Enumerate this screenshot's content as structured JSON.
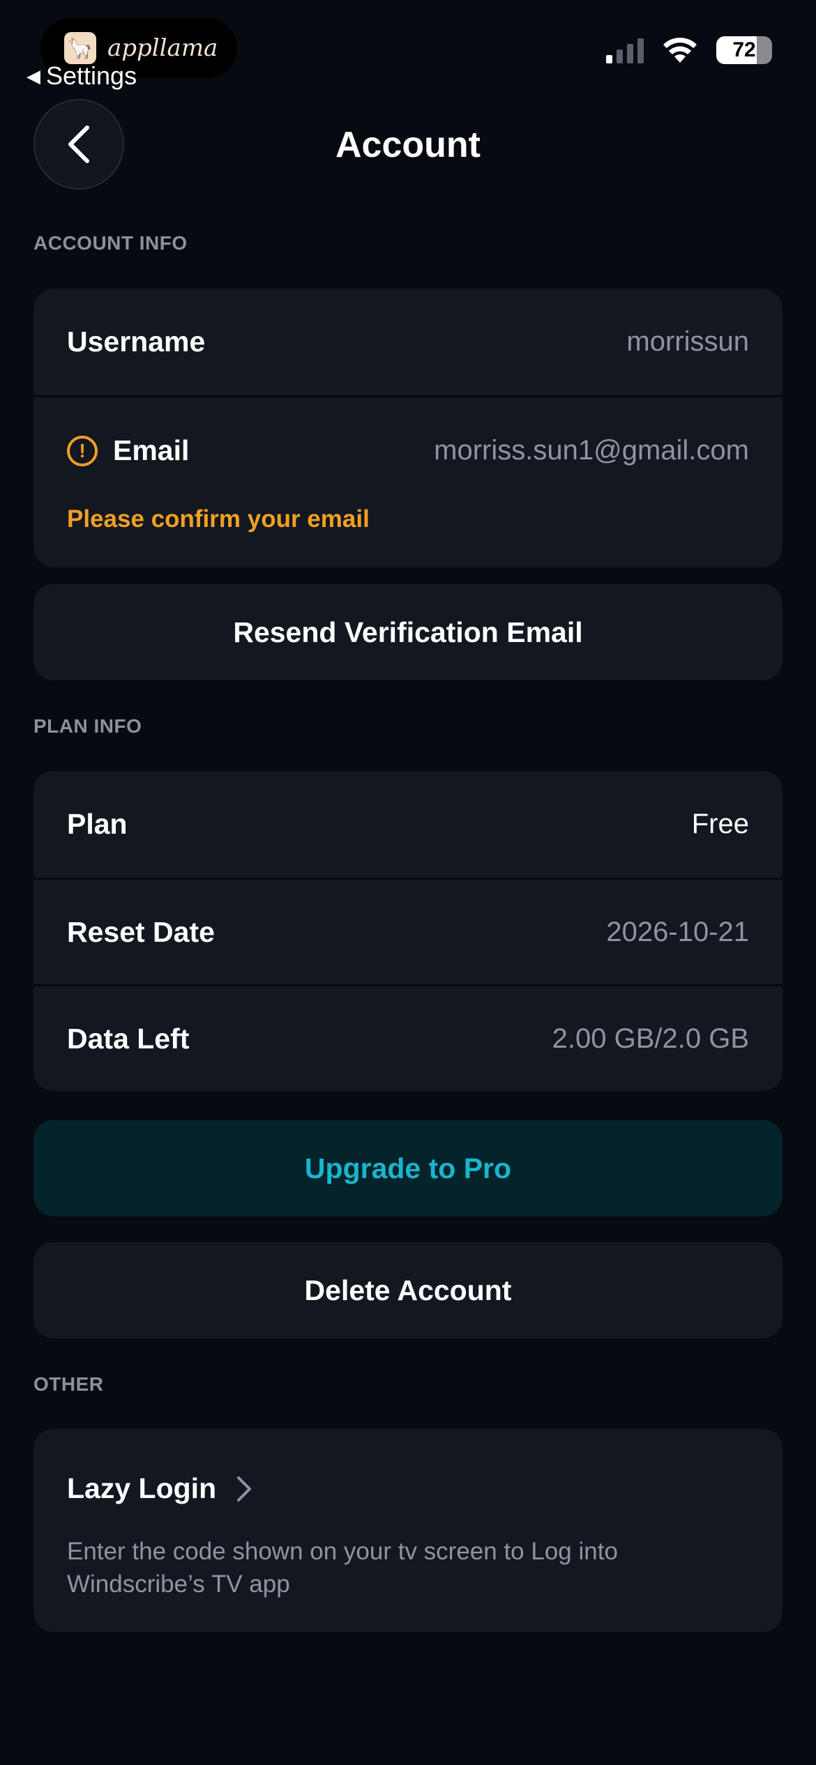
{
  "status_bar": {
    "app_pill_label": "appllama",
    "back_label": "Settings",
    "battery": "72",
    "battery_level": 0.72
  },
  "header": {
    "title": "Account"
  },
  "account_info": {
    "section_label": "ACCOUNT INFO",
    "username_label": "Username",
    "username_value": "morrissun",
    "email_label": "Email",
    "email_value": "morriss.sun1@gmail.com",
    "email_warning": "Please confirm your email",
    "resend_button": "Resend Verification Email"
  },
  "plan_info": {
    "section_label": "PLAN INFO",
    "plan_label": "Plan",
    "plan_value": "Free",
    "reset_label": "Reset Date",
    "reset_value": "2026-10-21",
    "data_label": "Data Left",
    "data_value": "2.00 GB/2.0 GB",
    "upgrade_button": "Upgrade to Pro",
    "delete_button": "Delete Account"
  },
  "other": {
    "section_label": "OTHER",
    "lazy_login_label": "Lazy Login",
    "lazy_login_description": "Enter the code shown on your tv screen to Log into Windscribe’s TV app"
  },
  "colors": {
    "background": "#070a10",
    "card": "#121720",
    "warning": "#f2a024",
    "accent": "#1ab5cc",
    "pro_button_bg": "#04232b"
  }
}
